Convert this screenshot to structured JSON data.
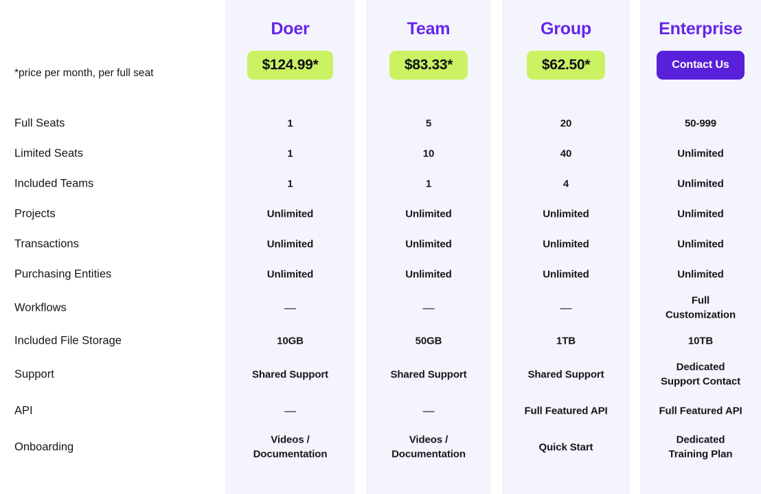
{
  "footnote": "*price per month, per full seat",
  "colors": {
    "plan_name": "#6526e8",
    "price_pill_bg": "#cbf263",
    "contact_button_bg": "#5820d9",
    "column_bg": "#f4f4fd",
    "page_bg": "#ffffff",
    "text": "#15161a"
  },
  "plans": [
    {
      "name": "Doer",
      "price": "$124.99*",
      "cta": null
    },
    {
      "name": "Team",
      "price": "$83.33*",
      "cta": null
    },
    {
      "name": "Group",
      "price": "$62.50*",
      "cta": null
    },
    {
      "name": "Enterprise",
      "price": null,
      "cta": "Contact Us"
    }
  ],
  "features": [
    {
      "label": "Full Seats",
      "values": [
        "1",
        "5",
        "20",
        "50-999"
      ]
    },
    {
      "label": "Limited Seats",
      "values": [
        "1",
        "10",
        "40",
        "Unlimited"
      ]
    },
    {
      "label": "Included Teams",
      "values": [
        "1",
        "1",
        "4",
        "Unlimited"
      ]
    },
    {
      "label": "Projects",
      "values": [
        "Unlimited",
        "Unlimited",
        "Unlimited",
        "Unlimited"
      ]
    },
    {
      "label": "Transactions",
      "values": [
        "Unlimited",
        "Unlimited",
        "Unlimited",
        "Unlimited"
      ]
    },
    {
      "label": "Purchasing Entities",
      "values": [
        "Unlimited",
        "Unlimited",
        "Unlimited",
        "Unlimited"
      ]
    },
    {
      "label": "Workflows",
      "values": [
        "—",
        "—",
        "—",
        "Full\nCustomization"
      ]
    },
    {
      "label": "Included File Storage",
      "values": [
        "10GB",
        "50GB",
        "1TB",
        "10TB"
      ]
    },
    {
      "label": "Support",
      "values": [
        "Shared Support",
        "Shared Support",
        "Shared Support",
        "Dedicated\nSupport Contact"
      ]
    },
    {
      "label": "API",
      "values": [
        "—",
        "—",
        "Full Featured API",
        "Full Featured API"
      ]
    },
    {
      "label": "Onboarding",
      "values": [
        "Videos /\nDocumentation",
        "Videos /\nDocumentation",
        "Quick Start",
        "Dedicated\nTraining Plan"
      ]
    }
  ]
}
